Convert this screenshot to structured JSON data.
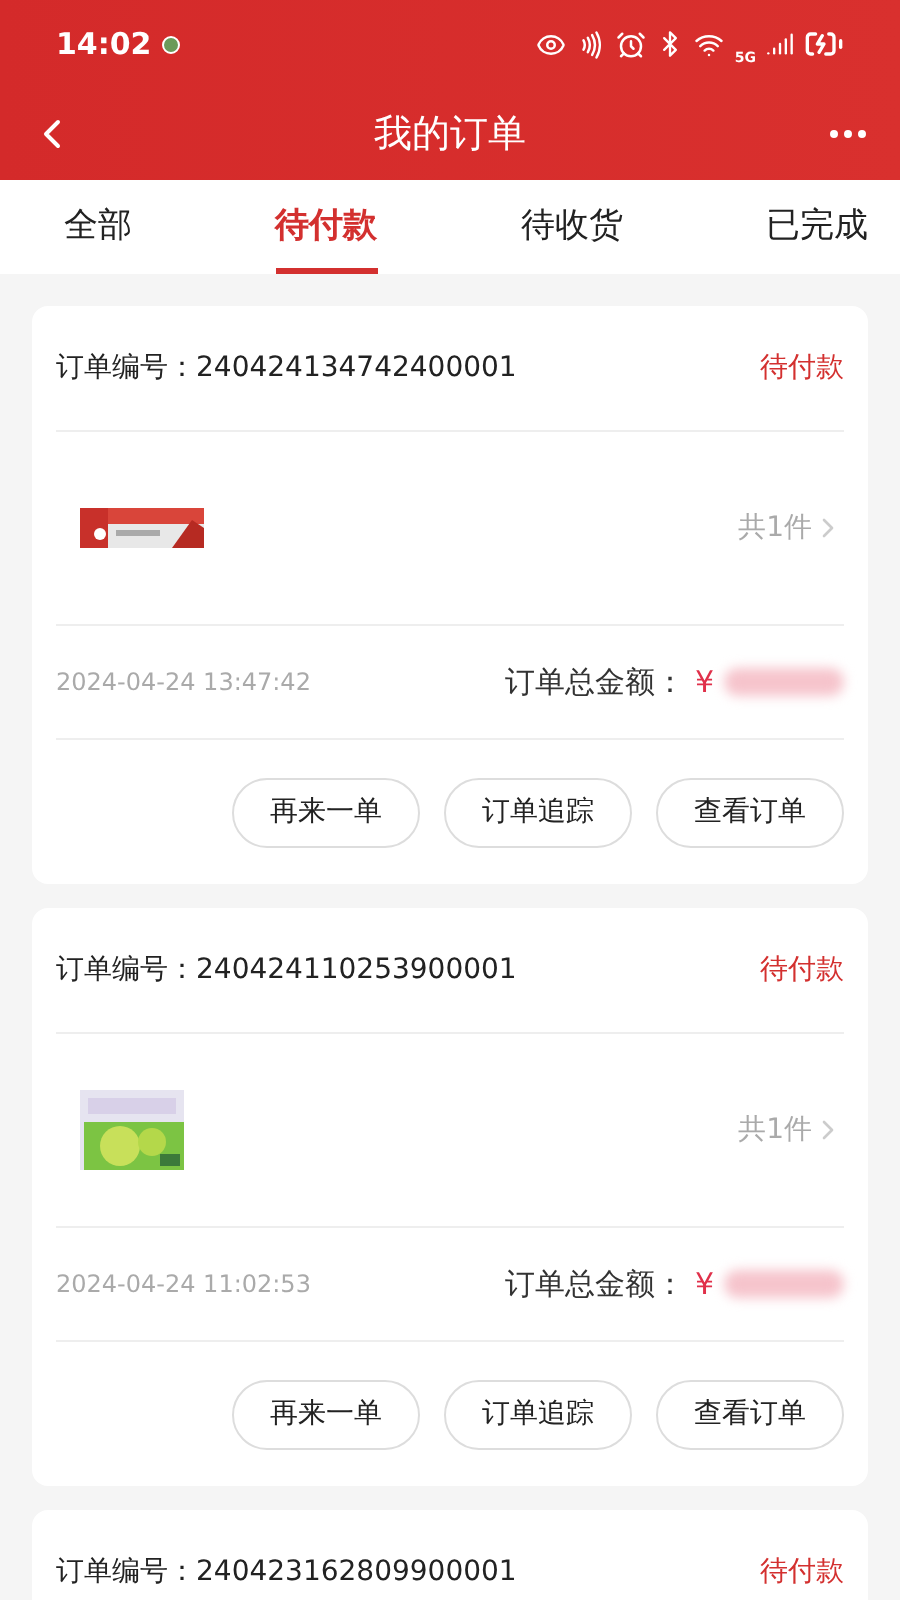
{
  "status_bar": {
    "time": "14:02",
    "network": "5G"
  },
  "header": {
    "title": "我的订单"
  },
  "tabs": [
    {
      "label": "全部",
      "selected": false
    },
    {
      "label": "待付款",
      "selected": true
    },
    {
      "label": "待收货",
      "selected": false
    },
    {
      "label": "已完成",
      "selected": false
    }
  ],
  "orders": [
    {
      "number_label": "订单编号：",
      "number": "240424134742400001",
      "status": "待付款",
      "product": {
        "kind": "picture"
      },
      "count": "共1件",
      "time": "2024-04-24 13:47:42",
      "total_label": "订单总金额：",
      "currency": "¥",
      "buttons": [
        "再来一单",
        "订单追踪",
        "查看订单"
      ]
    },
    {
      "number_label": "订单编号：",
      "number": "240424110253900001",
      "status": "待付款",
      "product": {
        "kind": "picture"
      },
      "count": "共1件",
      "time": "2024-04-24 11:02:53",
      "total_label": "订单总金额：",
      "currency": "¥",
      "buttons": [
        "再来一单",
        "订单追踪",
        "查看订单"
      ]
    },
    {
      "number_label": "订单编号：",
      "number": "240423162809900001",
      "status": "待付款"
    }
  ]
}
